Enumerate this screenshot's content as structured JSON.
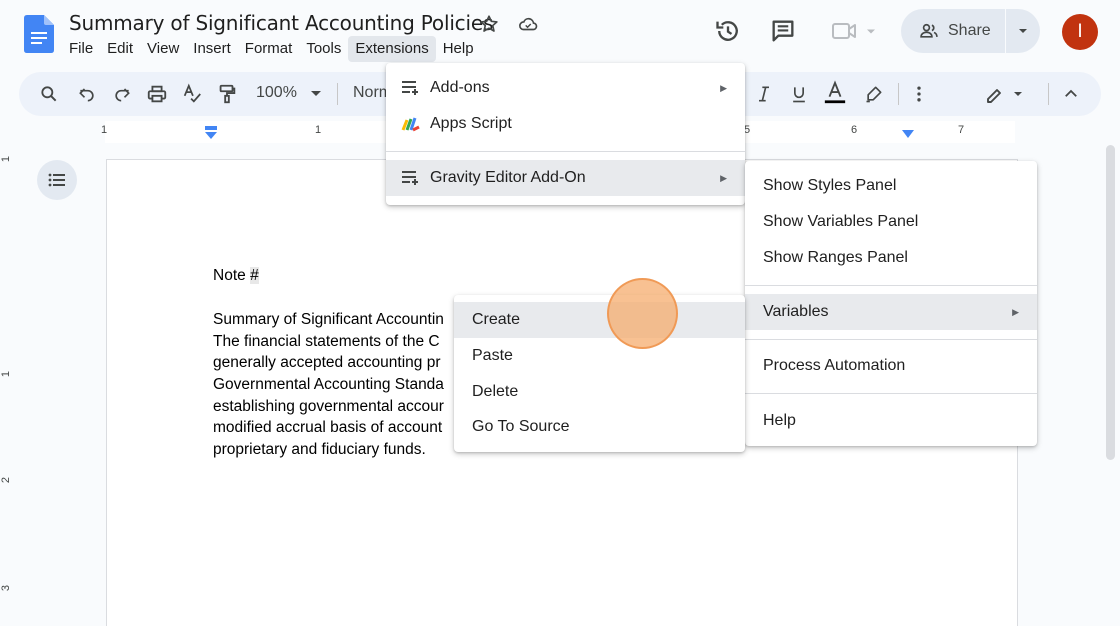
{
  "header": {
    "doc_title": "Summary of Significant Accounting Policies",
    "menus": [
      "File",
      "Edit",
      "View",
      "Insert",
      "Format",
      "Tools",
      "Extensions",
      "Help"
    ],
    "active_menu": "Extensions",
    "share_label": "Share",
    "avatar_initial": "I"
  },
  "toolbar": {
    "zoom": "100%",
    "style": "Norm"
  },
  "ruler": {
    "top_marks": [
      "1",
      "1",
      "5",
      "6",
      "7"
    ],
    "left_marks": [
      "1",
      "1",
      "2",
      "3"
    ]
  },
  "document": {
    "note_label": "Note ",
    "note_hash": "#",
    "lines": [
      "Summary of Significant Accountin",
      "The financial statements of the C",
      "generally accepted accounting pr",
      "Governmental Accounting Standa",
      "establishing governmental accour",
      "modified accrual basis of account",
      "proprietary and fiduciary funds."
    ]
  },
  "extensions_menu": {
    "items": [
      {
        "label": "Add-ons",
        "icon": "add-ons-icon",
        "submenu": true
      },
      {
        "label": "Apps Script",
        "icon": "apps-script-icon",
        "submenu": false
      },
      {
        "label": "Gravity Editor Add-On",
        "icon": "addon-list-icon",
        "submenu": true
      }
    ]
  },
  "gravity_menu": {
    "items": [
      "Show Styles Panel",
      "Show Variables Panel",
      "Show Ranges Panel",
      "Variables",
      "Process Automation",
      "Help"
    ]
  },
  "variables_menu": {
    "items": [
      "Create",
      "Paste",
      "Delete",
      "Go To Source"
    ]
  },
  "colors": {
    "accent_blue": "#4285f4",
    "avatar": "#c1330f",
    "toolbar_bg": "#edf2fa",
    "highlight": "#e8eaed"
  }
}
